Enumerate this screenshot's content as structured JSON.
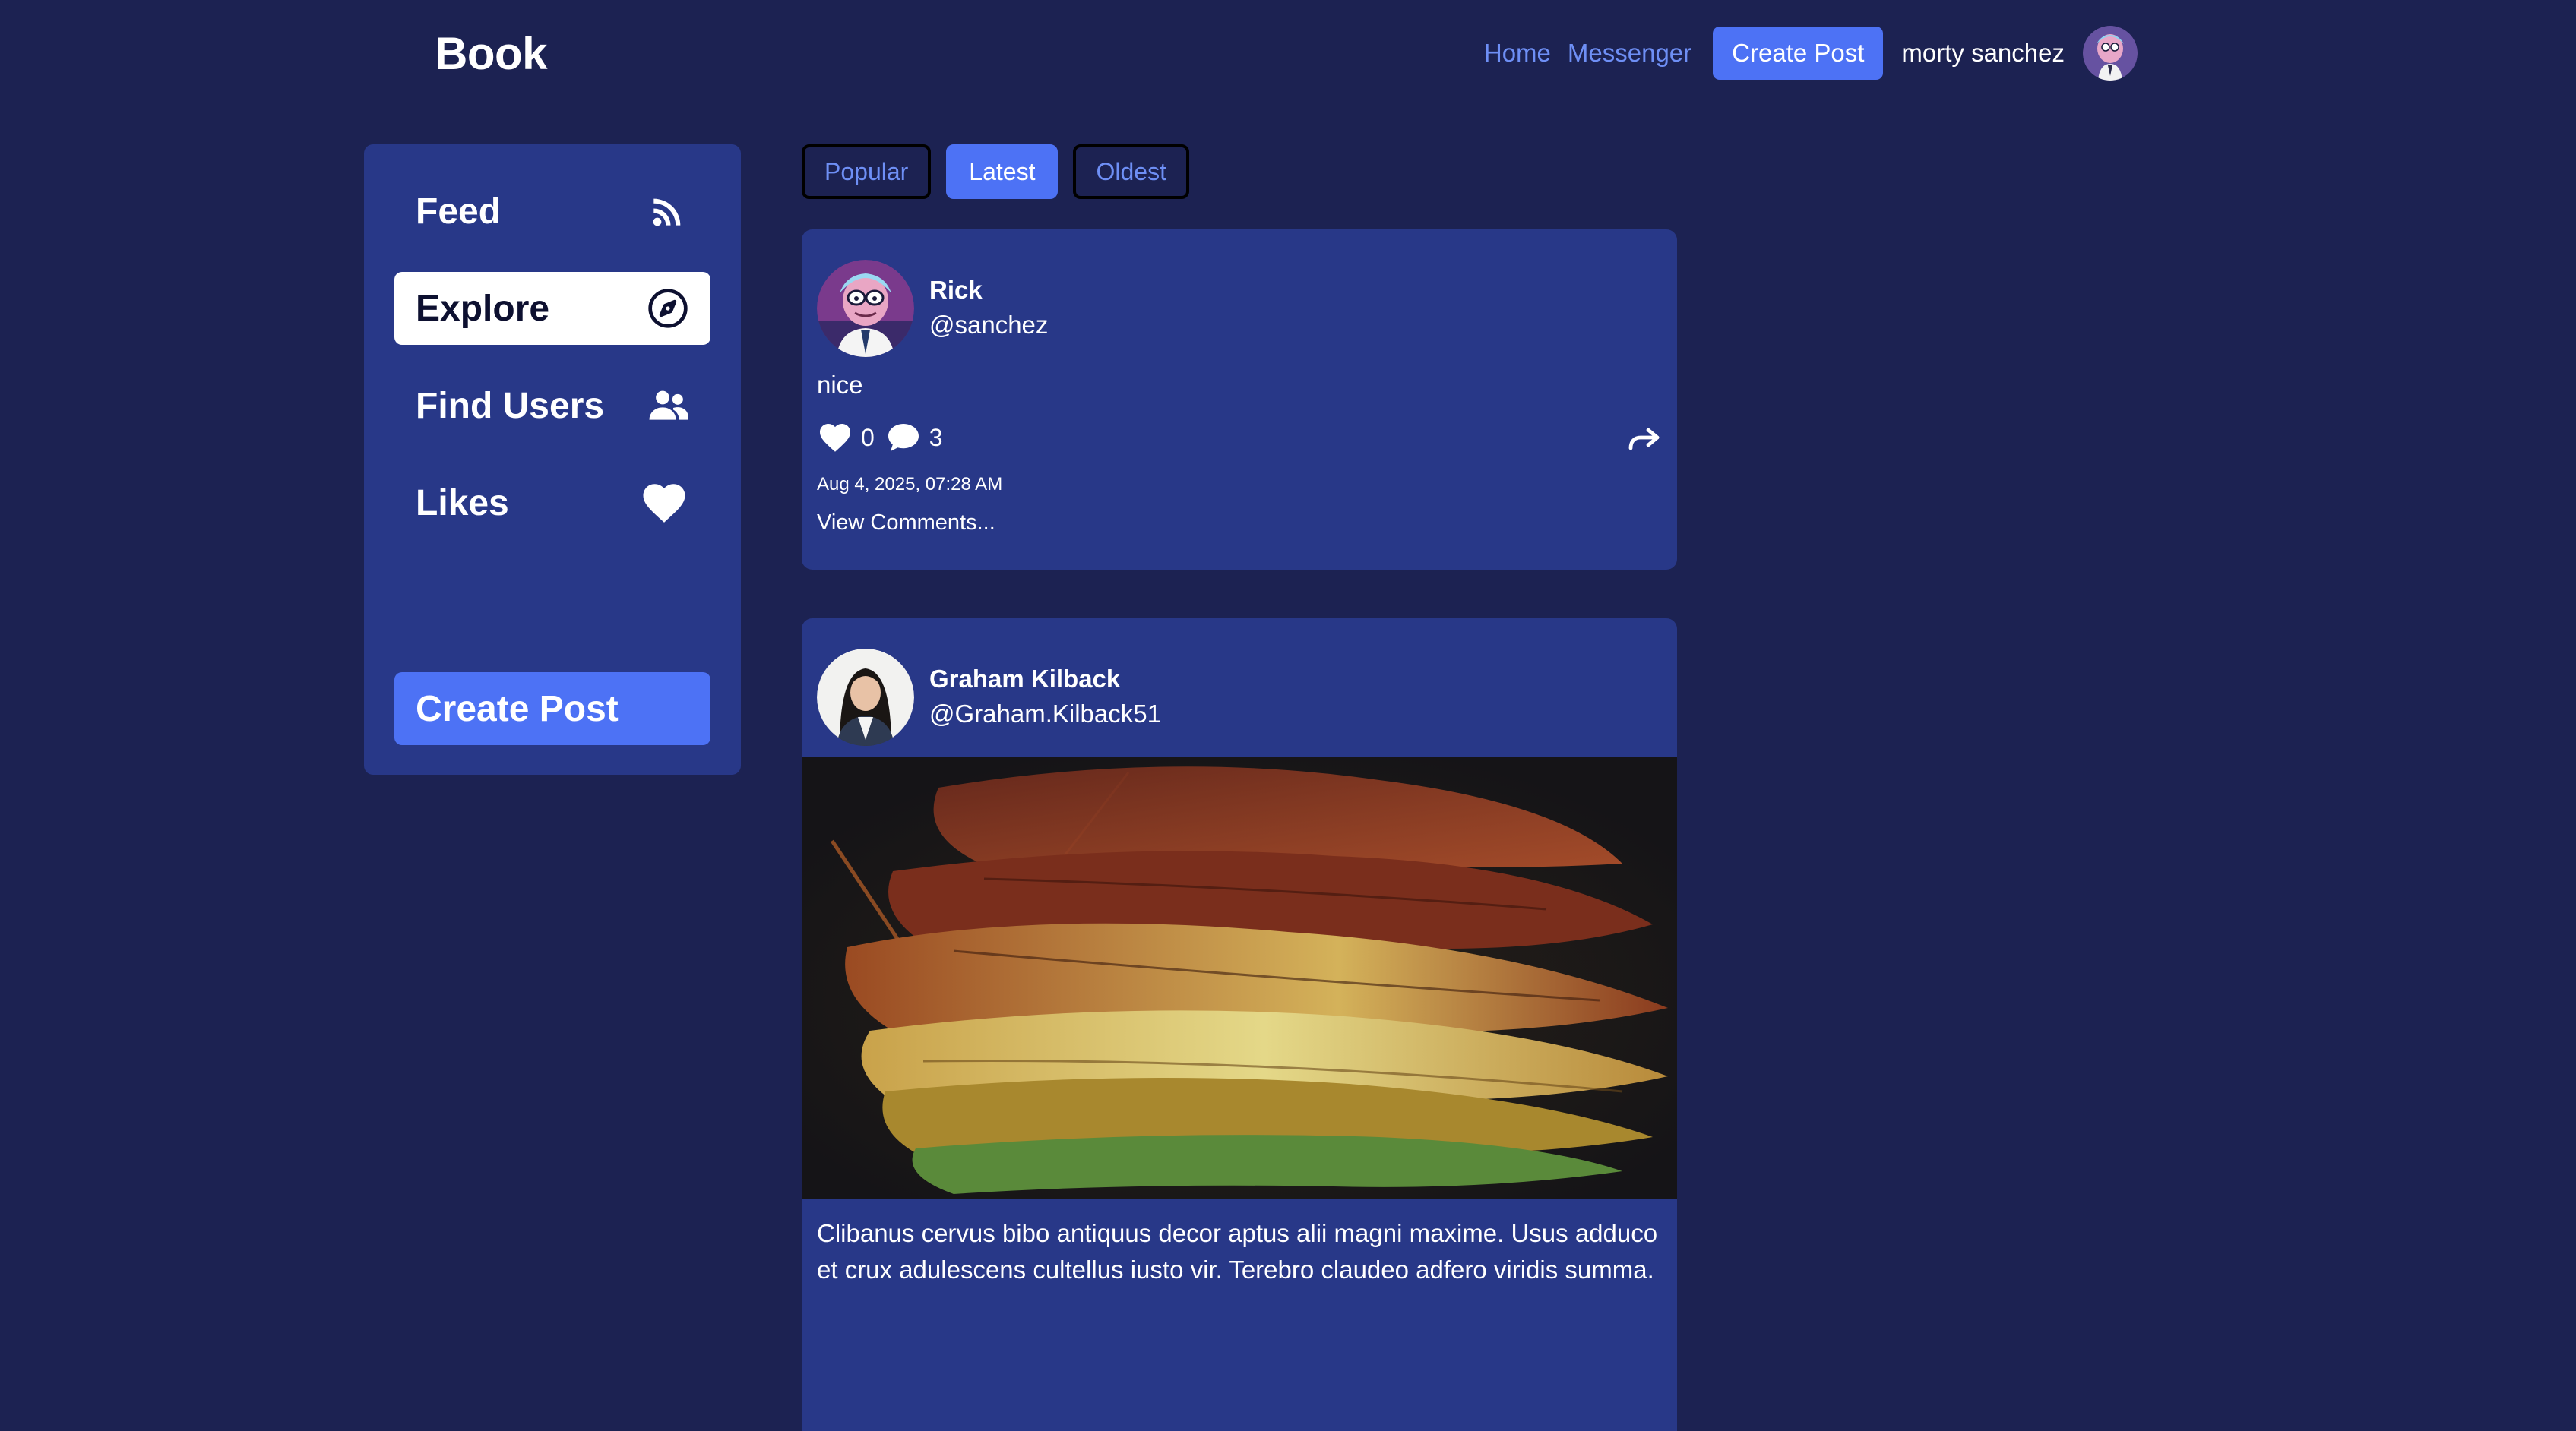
{
  "app": {
    "brand": "Book"
  },
  "topnav": {
    "home": "Home",
    "messenger": "Messenger",
    "create_post": "Create Post",
    "username": "morty sanchez"
  },
  "sidebar": {
    "items": [
      {
        "label": "Feed",
        "icon": "rss-icon"
      },
      {
        "label": "Explore",
        "icon": "compass-icon",
        "active": true
      },
      {
        "label": "Find Users",
        "icon": "users-icon"
      },
      {
        "label": "Likes",
        "icon": "heart-icon"
      }
    ],
    "create_post": "Create Post"
  },
  "filters": {
    "tabs": [
      "Popular",
      "Latest",
      "Oldest"
    ],
    "selected": "Latest"
  },
  "posts": [
    {
      "name": "Rick",
      "handle": "@sanchez",
      "text": "nice",
      "likes": "0",
      "comments": "3",
      "date": "Aug 4, 2025, 07:28 AM",
      "view_comments": "View Comments..."
    },
    {
      "name": "Graham Kilback",
      "handle": "@Graham.Kilback51",
      "caption": "Clibanus cervus bibo antiquus decor aptus alii magni maxime. Usus adduco et crux adulescens cultellus iusto vir. Terebro claudeo adfero viridis summa."
    }
  ],
  "colors": {
    "background": "#1c2252",
    "card": "#283888",
    "accent": "#4d72f5",
    "link": "#6e8ff5"
  }
}
